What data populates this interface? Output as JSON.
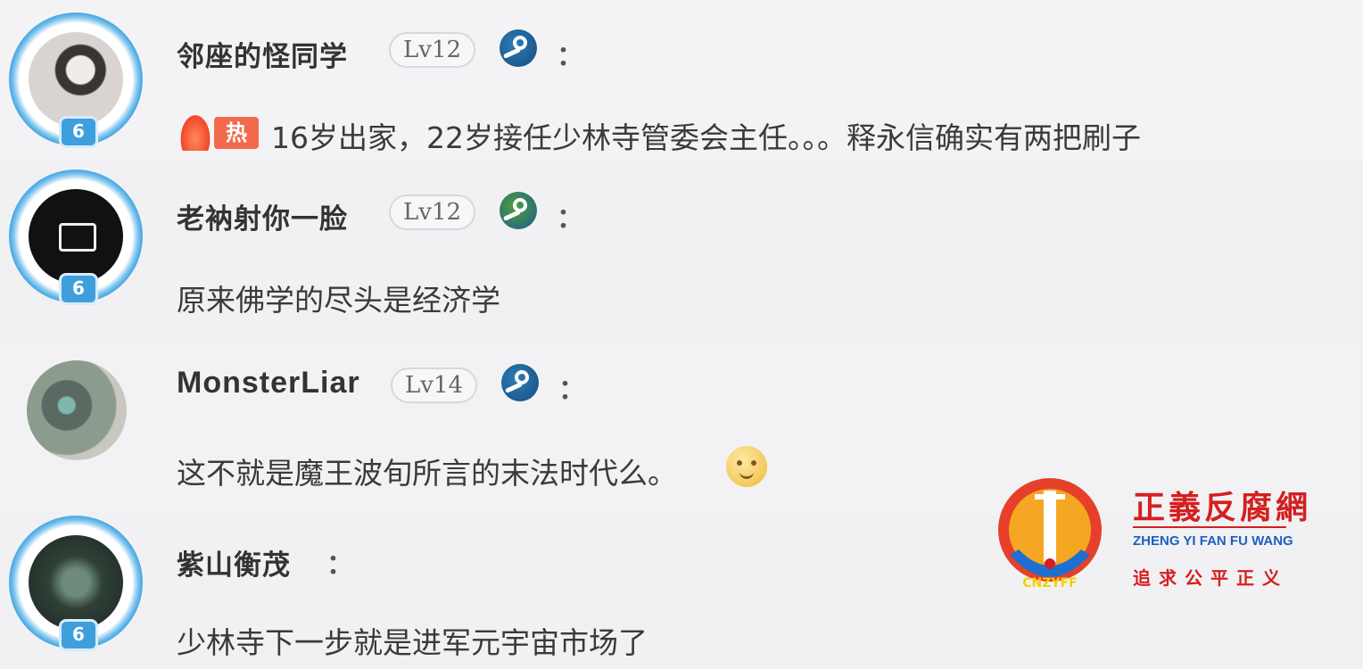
{
  "comments": [
    {
      "username": "邻座的怪同学",
      "level": "Lv12",
      "avatar_level": "6",
      "hot_label": "热",
      "text": "16岁出家，22岁接任少林寺管委会主任。。。释永信确实有两把刷子"
    },
    {
      "username": "老衲射你一脸",
      "level": "Lv12",
      "avatar_level": "6",
      "text": "原来佛学的尽头是经济学"
    },
    {
      "username": "MonsterLiar",
      "level": "Lv14",
      "text": "这不就是魔王波旬所言的末法时代么。"
    },
    {
      "username": "紫山衡茂",
      "avatar_level": "6",
      "text": "少林寺下一步就是进军元宇宙市场了"
    }
  ],
  "colon": "：",
  "watermark": {
    "title": "正義反腐網",
    "pinyin": "ZHENG YI FAN FU WANG",
    "slogan": "追求公平正义",
    "logo_text": "CNZYFF"
  }
}
